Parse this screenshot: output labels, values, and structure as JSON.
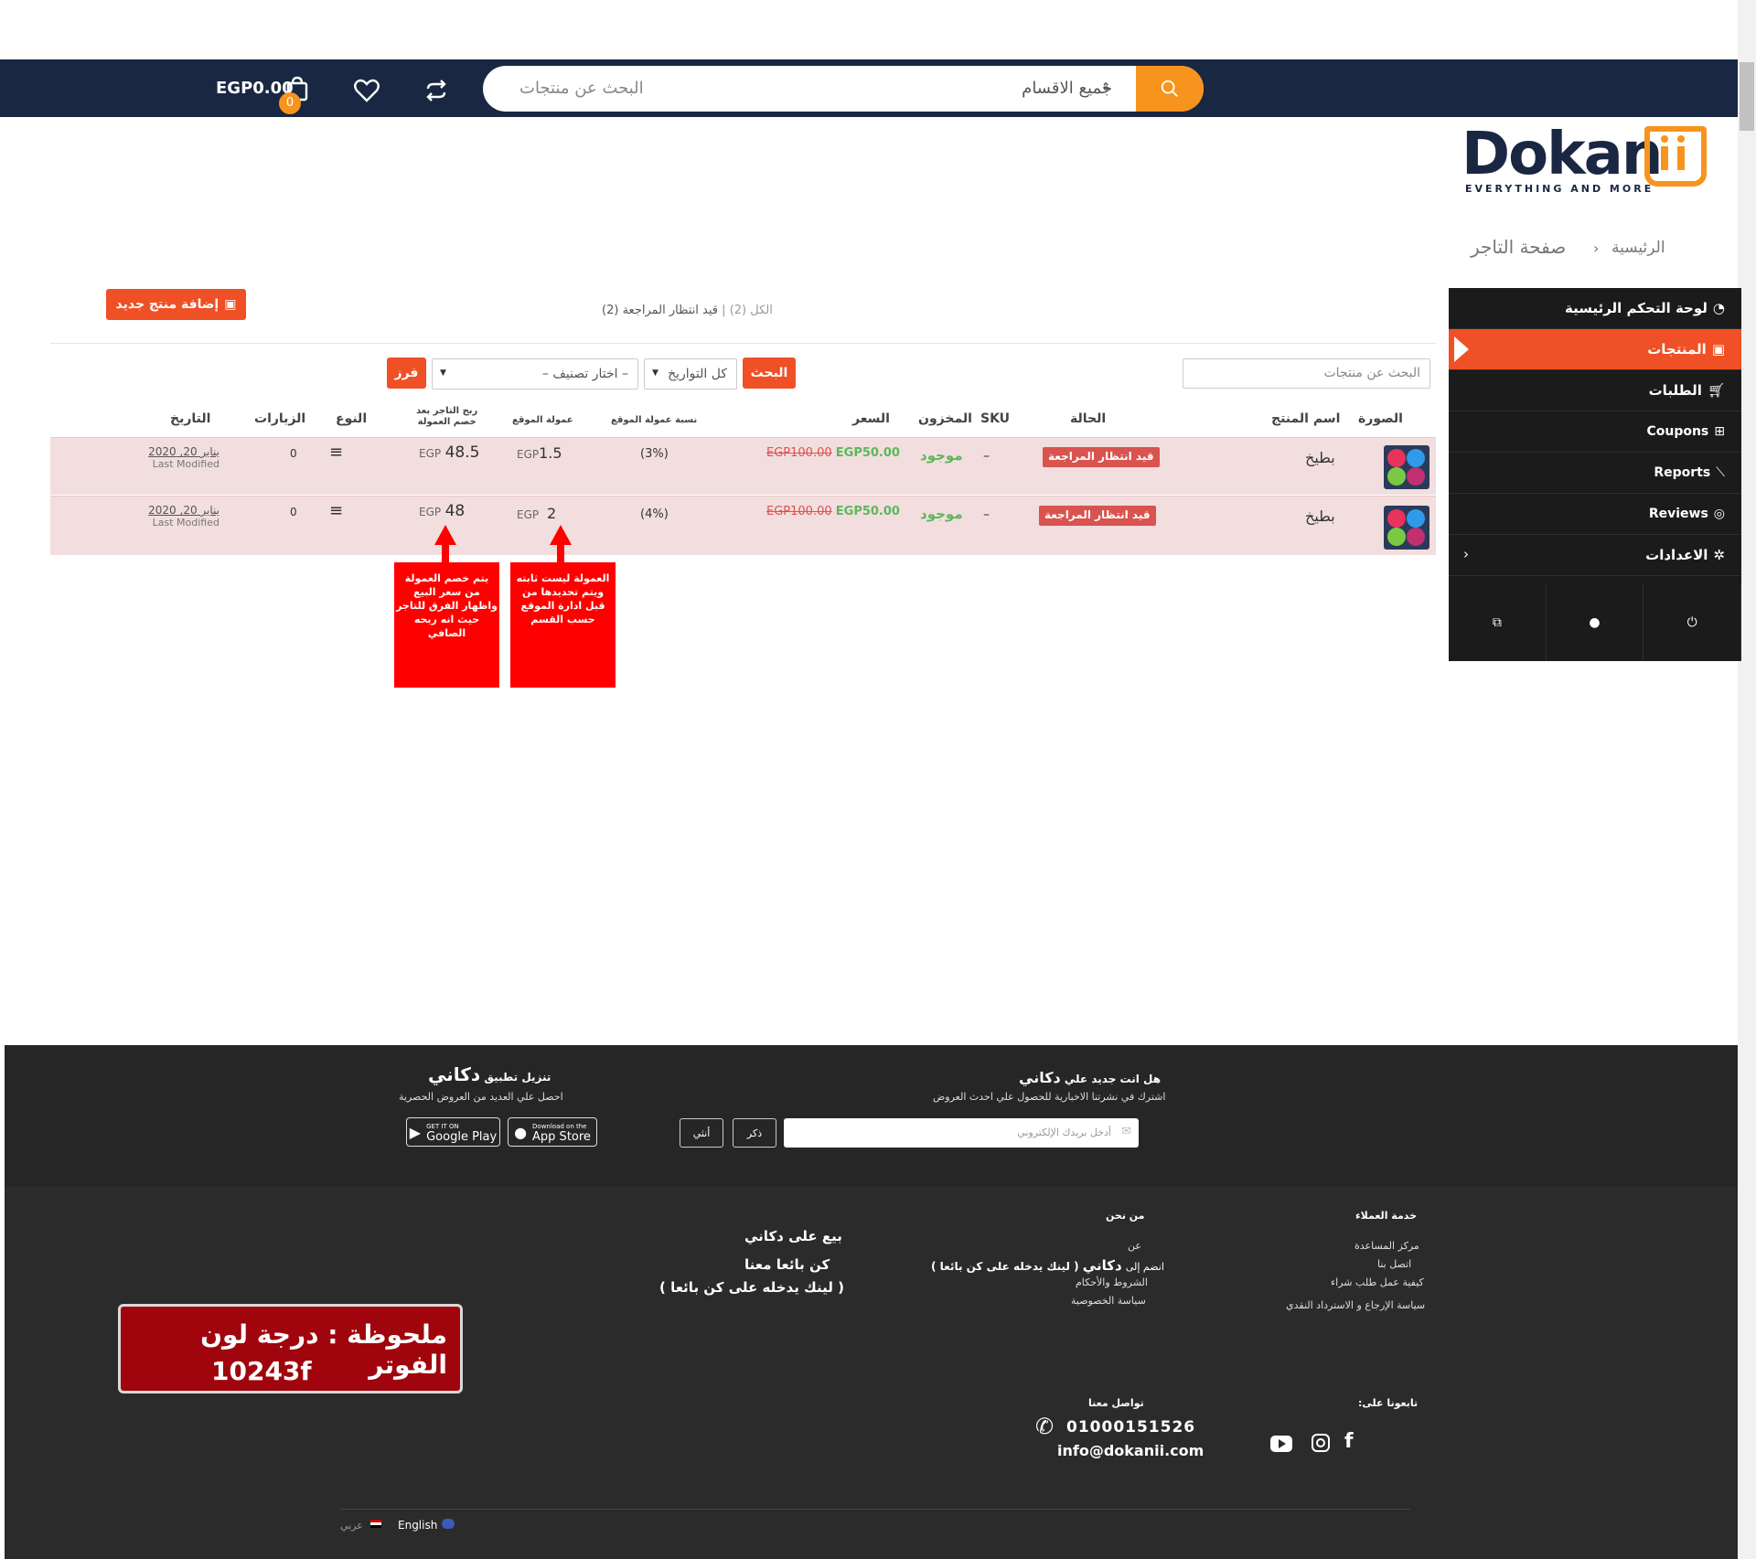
{
  "header": {
    "search_placeholder": "البحث عن منتجات",
    "category_select": "جميع الاقسام",
    "cart_amount": "EGP0.00",
    "cart_count": "0"
  },
  "logo": {
    "name": "Dokan",
    "tagline": "EVERYTHING AND MORE"
  },
  "breadcrumb": {
    "home": "الرئيسية",
    "separator": "›",
    "current": "صفحة التاجر"
  },
  "sidebar": {
    "items": [
      {
        "label": "لوحة التحكم الرئيسية",
        "icon": "dashboard-icon"
      },
      {
        "label": "المنتجات",
        "icon": "briefcase-icon"
      },
      {
        "label": "الطلبات",
        "icon": "cart-icon"
      },
      {
        "label": "Coupons",
        "icon": "gift-icon"
      },
      {
        "label": "Reports",
        "icon": "chart-icon"
      },
      {
        "label": "Reviews",
        "icon": "comments-icon"
      },
      {
        "label": "الاعدادات",
        "icon": "cog-icon"
      }
    ]
  },
  "toolbar": {
    "add_product": "إضافة منتج جديد",
    "filter_all": "الكل",
    "filter_all_count": "(2)",
    "filter_pending": "قيد انتظار المراجعة",
    "filter_pending_count": "(2)",
    "search_placeholder": "البحث عن منتجات",
    "search_button": "البحث",
    "dates_select": "كل التواريخ",
    "category_select": "– اختار تصنيف –",
    "sort_button": "فرز"
  },
  "table": {
    "headers": {
      "image": "الصورة",
      "name": "اسم المنتج",
      "status": "الحالة",
      "sku": "SKU",
      "stock": "المخزون",
      "price": "السعر",
      "commission_rate": "نسبة عمولة الموقع",
      "commission": "عمولة الموقع",
      "vendor_profit_1": "ربح التاجر بعد",
      "vendor_profit_2": "خصم العمولة",
      "type": "النوع",
      "views": "الزيارات",
      "date": "التاريخ"
    },
    "rows": [
      {
        "name": "بطيخ",
        "status": "قيد انتظار المراجعة",
        "sku": "–",
        "stock": "موجود",
        "old_price": "EGP100.00",
        "new_price": "EGP50.00",
        "commission_rate": "(3%)",
        "commission_currency": "EGP",
        "commission": "1.5",
        "profit_currency": "EGP",
        "profit": "48.5",
        "views": "0",
        "date": "يناير 20, 2020",
        "date_sub": "Last Modified"
      },
      {
        "name": "بطيخ",
        "status": "قيد انتظار المراجعة",
        "sku": "–",
        "stock": "موجود",
        "old_price": "EGP100.00",
        "new_price": "EGP50.00",
        "commission_rate": "(4%)",
        "commission_currency": "EGP",
        "commission": "2",
        "profit_currency": "EGP",
        "profit": "48",
        "views": "0",
        "date": "يناير 20, 2020",
        "date_sub": "Last Modified"
      }
    ]
  },
  "annotations": {
    "profit_note": [
      "يتم خصم العمولة",
      "من سعر البيع",
      "واظهار الفرق للتاجر",
      "حيث انه ربحه",
      "الصافي"
    ],
    "commission_note": [
      "العمولة ليست ثابته",
      "ويتم تحديدها من",
      "قبل ادارة الموقع",
      "حسب القسم"
    ]
  },
  "footer": {
    "newsletter_title_1": "هل انت جديد علي",
    "newsletter_title_brand": "دكاني",
    "newsletter_sub": "اشترك في نشرتنا الاخبارية للحصول علي احدث العروض",
    "email_placeholder": "أدخل بريدك الإلكتروني",
    "male_btn": "ذكر",
    "female_btn": "أنثي",
    "app_title_1": "تنزيل تطبيق",
    "app_title_brand": "دكاني",
    "app_sub": "احصل علي العديد من العروض الحصرية",
    "google_small": "GET IT ON",
    "google_big": "Google Play",
    "apple_small": "Download on the",
    "apple_big": "App Store",
    "customer_service": {
      "title": "خدمة العملاء",
      "links": [
        "مركز المساعدة",
        "اتصل بنا",
        "كيفية عمل طلب شراء",
        "سياسة الإرجاع و الاسترداد النقدي"
      ]
    },
    "about": {
      "title": "من نحن",
      "links": [
        "عن",
        "الشروط والأحكام",
        "سياسة الخصوصية"
      ],
      "join_prefix": "انضم إلى",
      "join_brand": "دكاني",
      "join_link": "( لينك يدخله على كن بائعا )"
    },
    "sell": {
      "line1": "بيع على دكاني",
      "line2": "كن بائعا معنا",
      "line3": "( لينك يدخله على كن بائعا )"
    },
    "note": {
      "line1": "ملحوظة : درجة لون الفوتر",
      "line2": "10243f"
    },
    "follow_title": "تابعونا على:",
    "contact_title": "تواصل معنا",
    "phone": "01000151526",
    "email": "info@dokanii.com",
    "lang_en": "English",
    "lang_ar": "عربي"
  },
  "colors": {
    "header": "#1a2742",
    "accent": "#f05025",
    "search_accent": "#f7941d",
    "footer": "#2b2b2b",
    "annotation": "#ff0000"
  }
}
